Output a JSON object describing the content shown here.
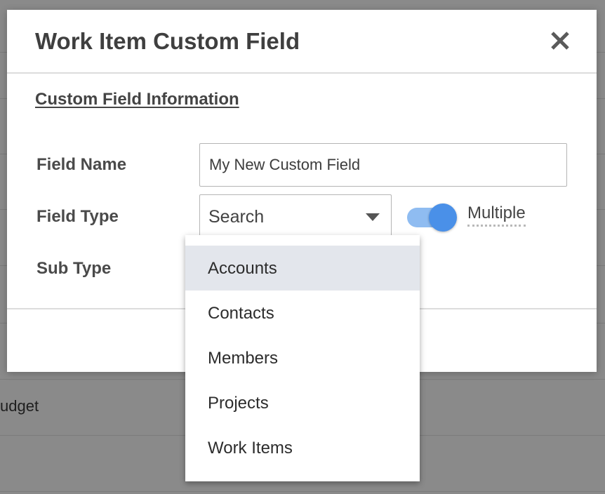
{
  "background": {
    "partial_text": "udget"
  },
  "dialog": {
    "title": "Work Item Custom Field",
    "close_icon": "close-icon"
  },
  "section": {
    "heading": "Custom Field Information"
  },
  "form": {
    "field_name": {
      "label": "Field Name",
      "value": "My New Custom Field"
    },
    "field_type": {
      "label": "Field Type",
      "selected": "Search",
      "caret_icon": "caret-down-icon"
    },
    "multiple_toggle": {
      "label": "Multiple",
      "on": true,
      "accent_color": "#4a90e8"
    },
    "sub_type": {
      "label": "Sub Type"
    }
  },
  "dropdown": {
    "highlighted_index": 0,
    "options": [
      {
        "label": "Accounts"
      },
      {
        "label": "Contacts"
      },
      {
        "label": "Members"
      },
      {
        "label": "Projects"
      },
      {
        "label": "Work Items"
      }
    ]
  }
}
